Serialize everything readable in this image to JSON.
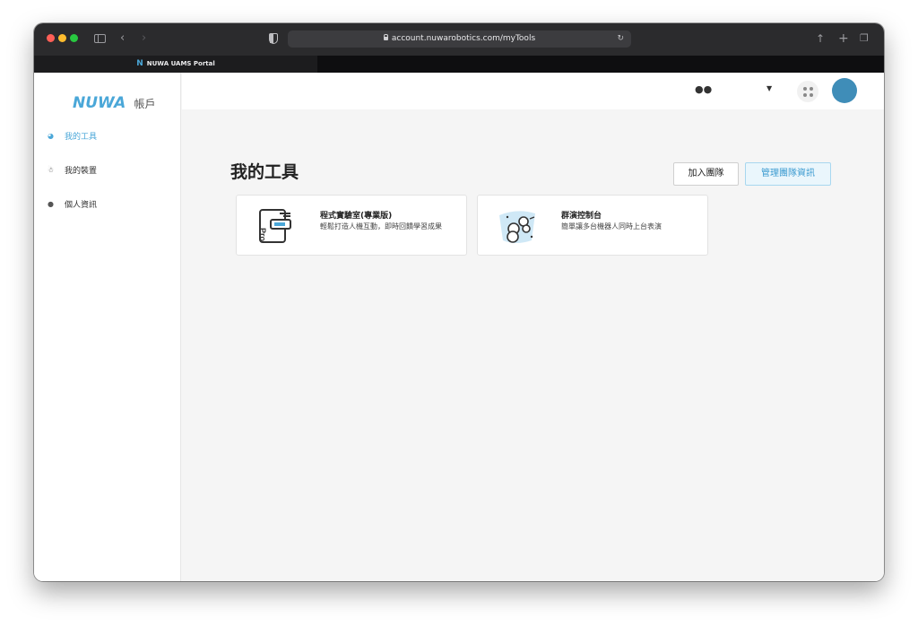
{
  "browser": {
    "url": "account.nuwarobotics.com/myTools",
    "tab_title": "NUWA UAMS Portal",
    "tab_logo": "N"
  },
  "sidebar": {
    "brand_logo": "NUWA",
    "brand_sub": "帳戶",
    "items": [
      {
        "label": "我的工具",
        "icon": "dashboard-icon",
        "active": true
      },
      {
        "label": "我的裝置",
        "icon": "robot-icon",
        "active": false
      },
      {
        "label": "個人資訊",
        "icon": "users-icon",
        "active": false
      }
    ]
  },
  "header": {
    "team_icon": "team-icon",
    "apps_icon": "apps-grid-icon"
  },
  "main": {
    "title": "我的工具",
    "join_team_label": "加入團隊",
    "manage_team_label": "管理團隊資訊",
    "tools": [
      {
        "title": "程式實驗室(專業版)",
        "description": "輕鬆打造人機互動，即時回饋學習成果"
      },
      {
        "title": "群演控制台",
        "description": "簡單讓多台機器人同時上台表演"
      }
    ]
  },
  "colors": {
    "accent": "#4aa7d8",
    "avatar": "#3f8db8",
    "manage_btn_bg": "#eaf6fc"
  }
}
